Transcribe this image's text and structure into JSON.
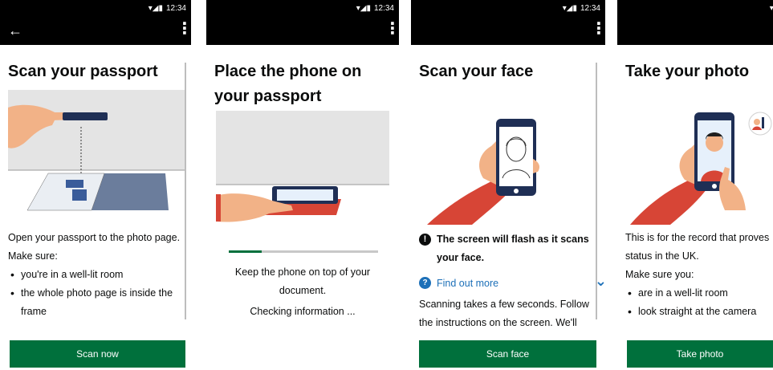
{
  "status_bar": {
    "time": "12:34"
  },
  "screens": [
    {
      "title": "Scan your passport",
      "intro": "Open your passport to the photo page.",
      "make_sure": "Make sure:",
      "bullets": [
        "you're in a well-lit room",
        "the whole photo page is inside the"
      ],
      "bullet_continuation": "frame",
      "button": "Scan now"
    },
    {
      "title_line1": "Place the phone on",
      "title_line2": "your passport",
      "instruction_line1": "Keep the phone on top of your",
      "instruction_line2": "document.",
      "status": "Checking information ...",
      "progress": 0.22
    },
    {
      "title": "Scan your face",
      "warning_line1": "The screen will flash as it scans",
      "warning_line2": "your face.",
      "find_out_more": "Find out more",
      "detail_line1": "Scanning takes a few seconds. Follow",
      "detail_line2": "the instructions on the screen. We'll",
      "button": "Scan face"
    },
    {
      "title": "Take your photo",
      "line1": "This is for the record that proves",
      "line2": "status in the UK.",
      "make_sure": "Make sure you:",
      "bullets": [
        "are in a well-lit room",
        "look straight at the camera"
      ],
      "button": "Take photo"
    }
  ],
  "icons": {
    "back": "arrow-left-icon",
    "menu": "more-vertical-icon",
    "warning": "exclamation-icon",
    "help": "question-icon",
    "expand": "chevron-down-icon"
  },
  "colors": {
    "brand_green": "#00703c",
    "link_blue": "#1d70b8",
    "bar_black": "#000000"
  }
}
